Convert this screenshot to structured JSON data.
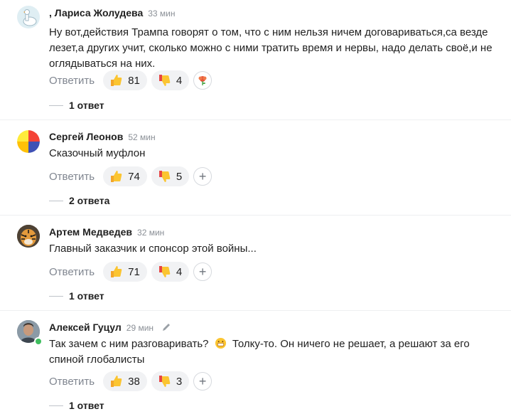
{
  "comments": [
    {
      "author": ", Лариса Жолудева",
      "time": "33 мин",
      "text": "Ну вот,действия Трампа говорят о том, что с ним нельзя ничем договариваться,са везде лезет,а других учит, сколько можно с ними тратить время и нервы, надо делать своё,и не оглядываться на них.",
      "reply_label": "Ответить",
      "likes": "81",
      "dislikes": "4",
      "extra_reaction": "flower",
      "answers": "1 ответ",
      "avatar": "goose"
    },
    {
      "author": "Сергей Леонов",
      "time": "52 мин",
      "text": "Сказочный муфлон",
      "reply_label": "Ответить",
      "likes": "74",
      "dislikes": "5",
      "answers": "2 ответа",
      "avatar": "pie"
    },
    {
      "author": "Артем Медведев",
      "time": "32 мин",
      "text": "Главный заказчик и спонсор этой войны...",
      "reply_label": "Ответить",
      "likes": "71",
      "dislikes": "4",
      "answers": "1 ответ",
      "avatar": "tiger"
    },
    {
      "author": "Алексей Гуцул",
      "time": "29 мин",
      "text_before": "Так зачем с ним разговаривать?",
      "text_after": "Толку-то. Он ничего не решает, а решают за его спиной глобалисты",
      "reply_label": "Ответить",
      "likes": "38",
      "dislikes": "3",
      "answers": "1 ответ",
      "avatar": "photo"
    }
  ],
  "colors": {
    "online": "#3ebd5e",
    "pill_bg": "#f1f2f4",
    "muted": "#8a8f96"
  }
}
